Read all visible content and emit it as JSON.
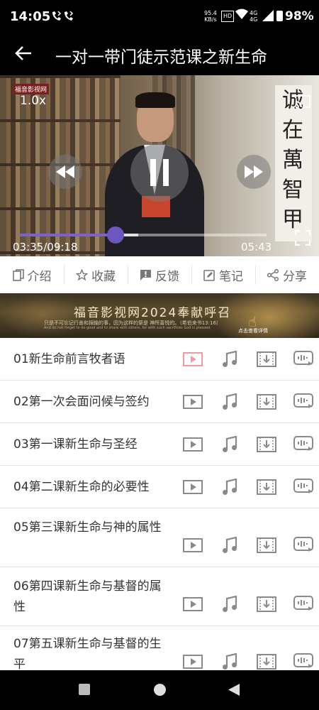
{
  "status_bar": {
    "time": "14:05",
    "net_speed": "95.4",
    "net_unit": "KB/s",
    "hd": "HD",
    "lte_top": "4G",
    "lte_bottom": "4G",
    "battery": "98%"
  },
  "app_bar": {
    "title": "一对一带门徒示范课之新生命"
  },
  "player": {
    "logo": "福音影视网",
    "speed": "1.0x",
    "current_time": "03:35/09:18",
    "remaining_time": "05:43",
    "progress": 0.387,
    "buffered": 0.48,
    "scroll_text": [
      "诚",
      "在",
      "萬",
      "智",
      "甲"
    ]
  },
  "actions": [
    {
      "label": "介绍",
      "icon": "copy-icon"
    },
    {
      "label": "收藏",
      "icon": "star-icon"
    },
    {
      "label": "反馈",
      "icon": "feedback-icon"
    },
    {
      "label": "笔记",
      "icon": "note-icon"
    },
    {
      "label": "分享",
      "icon": "share-icon"
    }
  ],
  "banner": {
    "title": "福音影视网2024奉献呼召",
    "subtitle": "只是不可忘记行善和捐输的事，因为这样的祭是 神所喜悦的。（希伯来书13:16）",
    "subtitle_en": "And do not forget to do good and to share with others, for with such sacrifices God is pleased.",
    "hint": "点击查看详情"
  },
  "lessons": [
    {
      "title": "01新生命前言牧者语",
      "active": true
    },
    {
      "title": "02第一次会面问候与签约",
      "active": false
    },
    {
      "title": "03第一课新生命与圣经",
      "active": false
    },
    {
      "title": "04第二课新生命的必要性",
      "active": false
    },
    {
      "title": "05第三课新生命与神的属性",
      "active": false
    },
    {
      "title": "06第四课新生命与基督的属性",
      "active": false
    },
    {
      "title": "07第五课新生命与基督的生平",
      "active": false
    }
  ],
  "colors": {
    "accent": "#7d63c8",
    "active_icon": "#f29b9b",
    "icon_gray": "#8a8a8a"
  }
}
